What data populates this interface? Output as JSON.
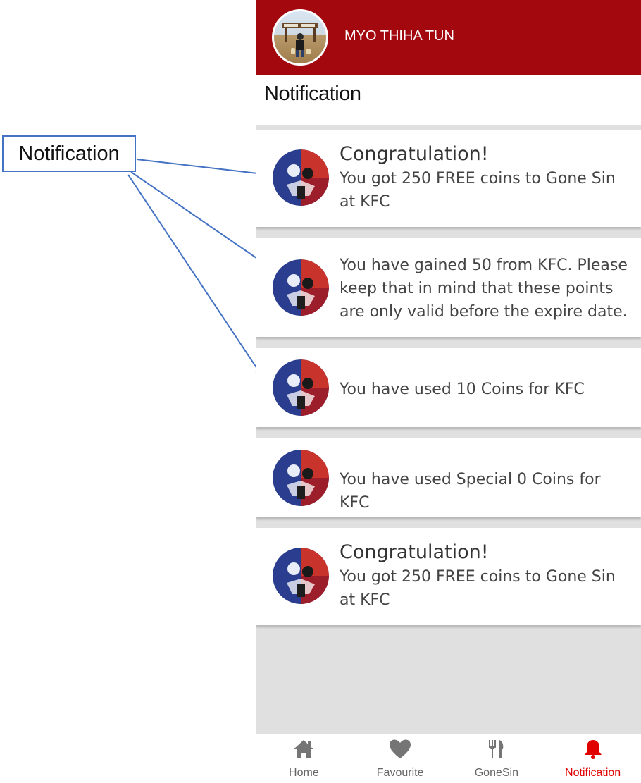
{
  "annotation": {
    "label": "Notification"
  },
  "header": {
    "user_name": "MYO THIHA TUN"
  },
  "page": {
    "title": "Notification"
  },
  "notifications": [
    {
      "heading": "Congratulation!",
      "body": "You got 250 FREE coins to  Gone Sin at KFC",
      "thumb": "anime-artwork-thumbnail"
    },
    {
      "heading": "",
      "body": "You have gained 50 from KFC. Please keep that in mind that these points are only valid before the expire date.",
      "thumb": "anime-artwork-thumbnail"
    },
    {
      "heading": "",
      "body": "You have used 10 Coins for KFC",
      "thumb": "anime-artwork-thumbnail"
    },
    {
      "heading": "",
      "body": "You have used Special 0 Coins for KFC",
      "thumb": "anime-artwork-thumbnail"
    },
    {
      "heading": "Congratulation!",
      "body": "You got 250 FREE coins to  Gone Sin at KFC",
      "thumb": "anime-artwork-thumbnail"
    }
  ],
  "bottom_nav": [
    {
      "label": "Home",
      "icon": "home-icon",
      "active": false
    },
    {
      "label": "Favourite",
      "icon": "heart-icon",
      "active": false
    },
    {
      "label": "GoneSin",
      "icon": "fork-knife-icon",
      "active": false
    },
    {
      "label": "Notification",
      "icon": "bell-icon",
      "active": true
    }
  ],
  "colors": {
    "appbar": "#a2080e",
    "active_tab": "#e00000",
    "inactive_icon": "#757575",
    "callout_border": "#4472c4"
  }
}
